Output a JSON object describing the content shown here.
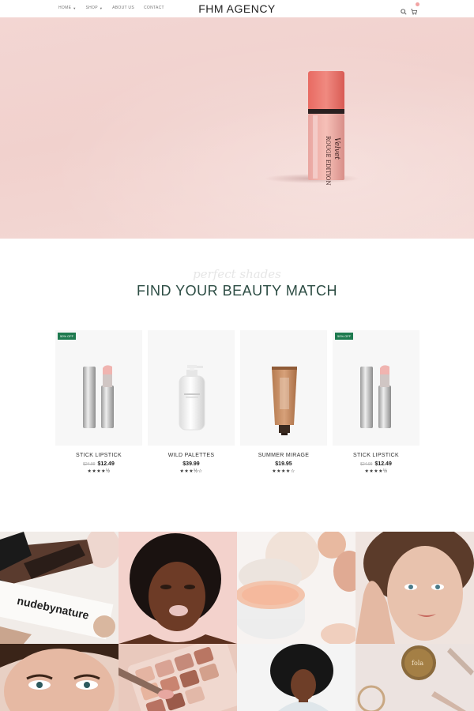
{
  "header": {
    "nav": [
      {
        "label": "HOME",
        "dropdown": true
      },
      {
        "label": "SHOP",
        "dropdown": true
      },
      {
        "label": "ABOUT US",
        "dropdown": false
      },
      {
        "label": "CONTACT",
        "dropdown": false
      }
    ],
    "brand": "FHM AGENCY",
    "icons": [
      "search-icon",
      "cart-icon"
    ]
  },
  "hero": {
    "image": "pink lipstick bottle on pink fabric",
    "product_text_line1": "ROUGE EDITION",
    "product_text_line2": "Velvet"
  },
  "section": {
    "script_text": "perfect shades",
    "title": "FIND YOUR BEAUTY MATCH"
  },
  "products": [
    {
      "name": "STICK LIPSTICK",
      "old_price": "$24.99",
      "price": "$12.49",
      "badge": "50% OFF",
      "rating": "★★★★½"
    },
    {
      "name": "WILD PALETTES",
      "old_price": "",
      "price": "$39.99",
      "badge": "",
      "rating": "★★★½☆"
    },
    {
      "name": "SUMMER MIRAGE",
      "old_price": "",
      "price": "$19.95",
      "badge": "",
      "rating": "★★★★☆"
    },
    {
      "name": "STICK LIPSTICK",
      "old_price": "$24.99",
      "price": "$12.49",
      "badge": "50% OFF",
      "rating": "★★★★½"
    }
  ],
  "gallery": {
    "tile_1_text": "nudebynature",
    "tile_8_text": "fola"
  },
  "colors": {
    "accent_green": "#2d4d44",
    "badge_green": "#1e7a4f",
    "hero_pink": "#f2d4d0"
  }
}
